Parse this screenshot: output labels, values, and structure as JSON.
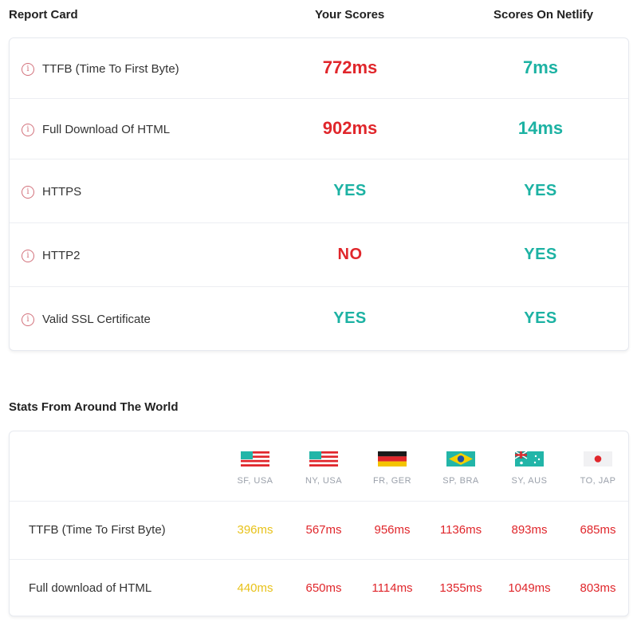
{
  "headers": {
    "report_card": "Report Card",
    "your_scores": "Your Scores",
    "netlify_scores": "Scores On Netlify"
  },
  "report_rows": [
    {
      "label": "TTFB (Time To First Byte)",
      "yours": "772ms",
      "netlify": "7ms"
    },
    {
      "label": "Full Download Of HTML",
      "yours": "902ms",
      "netlify": "14ms"
    },
    {
      "label": "HTTPS",
      "yours": "YES",
      "netlify": "YES"
    },
    {
      "label": "HTTP2",
      "yours": "NO",
      "netlify": "YES"
    },
    {
      "label": "Valid SSL Certificate",
      "yours": "YES",
      "netlify": "YES"
    }
  ],
  "info_icon_glyph": "i",
  "world": {
    "title": "Stats From Around The World",
    "locations": [
      {
        "code": "SF, USA",
        "flag": "usa-flag-icon"
      },
      {
        "code": "NY, USA",
        "flag": "usa-flag-icon"
      },
      {
        "code": "FR, GER",
        "flag": "germany-flag-icon"
      },
      {
        "code": "SP, BRA",
        "flag": "brazil-flag-icon"
      },
      {
        "code": "SY, AUS",
        "flag": "australia-flag-icon"
      },
      {
        "code": "TO, JAP",
        "flag": "japan-flag-icon"
      }
    ],
    "rows": [
      {
        "label": "TTFB (Time To First Byte)",
        "values": [
          "396ms",
          "567ms",
          "956ms",
          "1136ms",
          "893ms",
          "685ms"
        ]
      },
      {
        "label": "Full download of HTML",
        "values": [
          "440ms",
          "650ms",
          "1114ms",
          "1355ms",
          "1049ms",
          "803ms"
        ]
      }
    ]
  },
  "colors": {
    "bad": "#e0262b",
    "good": "#1cb2a3",
    "fast": "#e8c21a"
  }
}
